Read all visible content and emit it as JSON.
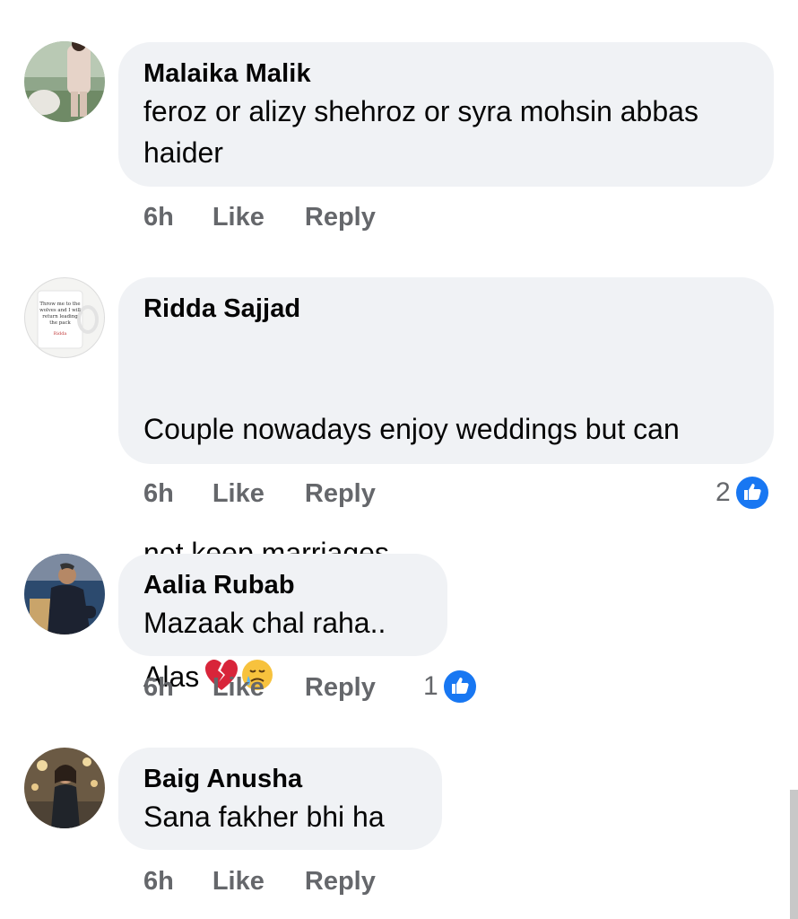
{
  "comments": [
    {
      "author": "Malaika Malik",
      "text": "feroz or alizy shehroz or syra mohsin abbas haider",
      "time": "6h",
      "like_label": "Like",
      "reply_label": "Reply",
      "reaction_count": null
    },
    {
      "author": "Ridda Sajjad",
      "text_line1": "Couple nowadays enjoy weddings but can",
      "text_line2": "not keep marriages..",
      "text_line3": "Alas",
      "emojis": [
        "broken-heart",
        "smiling-face-with-tear"
      ],
      "avatar_text": [
        "Throw me to the",
        "wolves and I will",
        "return leading",
        "the pack",
        "Ridda"
      ],
      "time": "6h",
      "like_label": "Like",
      "reply_label": "Reply",
      "reaction_count": "2"
    },
    {
      "author": "Aalia Rubab",
      "text": "Mazaak chal raha..",
      "time": "6h",
      "like_label": "Like",
      "reply_label": "Reply",
      "reaction_count": "1"
    },
    {
      "author": "Baig Anusha",
      "text": "Sana fakher bhi ha",
      "time": "6h",
      "like_label": "Like",
      "reply_label": "Reply",
      "reaction_count": null
    }
  ],
  "colors": {
    "bubble_bg": "#f0f2f5",
    "meta_text": "#65676b",
    "like_blue": "#1877f2"
  }
}
